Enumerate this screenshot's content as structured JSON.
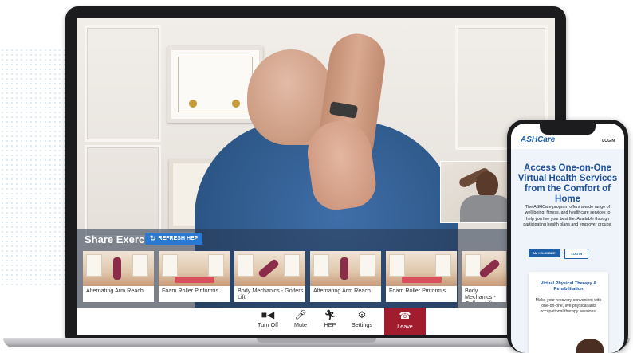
{
  "share": {
    "title": "Share Exercises",
    "refresh_label": "REFRESH HEP",
    "exercises": [
      {
        "label": "Alternating Arm Reach"
      },
      {
        "label": "Foam Roller Piriformis"
      },
      {
        "label": "Body Mechanics - Golfers Lift"
      },
      {
        "label": "Alternating Arm Reach"
      },
      {
        "label": "Foam Roller Piriformis"
      },
      {
        "label": "Body Mechanics - Golfers Lift"
      }
    ]
  },
  "controls": {
    "turn_off": "Turn Off",
    "mute": "Mute",
    "hep": "HEP",
    "settings": "Settings",
    "leave": "Leave"
  },
  "phone": {
    "logo": "ASHCare",
    "login": "LOGIN",
    "headline": "Access One-on-One Virtual Health Services from the Comfort of Home",
    "body": "The ASHCare program offers a wide range of well-being, fitness, and healthcare services to help you live your best life. Available through participating health plans and employer groups.",
    "eligible_button": "AM I ELIGIBLE?",
    "login_button": "LOG IN",
    "card_title": "Virtual Physical Therapy & Rehabilitation",
    "card_body": "Make your recovery convenient with one-on-one, live physical and occupational therapy sessions."
  },
  "colors": {
    "accent": "#1f5fa8",
    "refresh": "#2a78d2",
    "leave": "#a11d2e",
    "shirt": "#2f5a8c"
  },
  "icons": {
    "refresh": "refresh-icon",
    "camera": "video-camera-icon",
    "mic": "microphone-icon",
    "hep": "running-person-icon",
    "settings": "gear-icon",
    "leave": "phone-hangup-icon"
  }
}
